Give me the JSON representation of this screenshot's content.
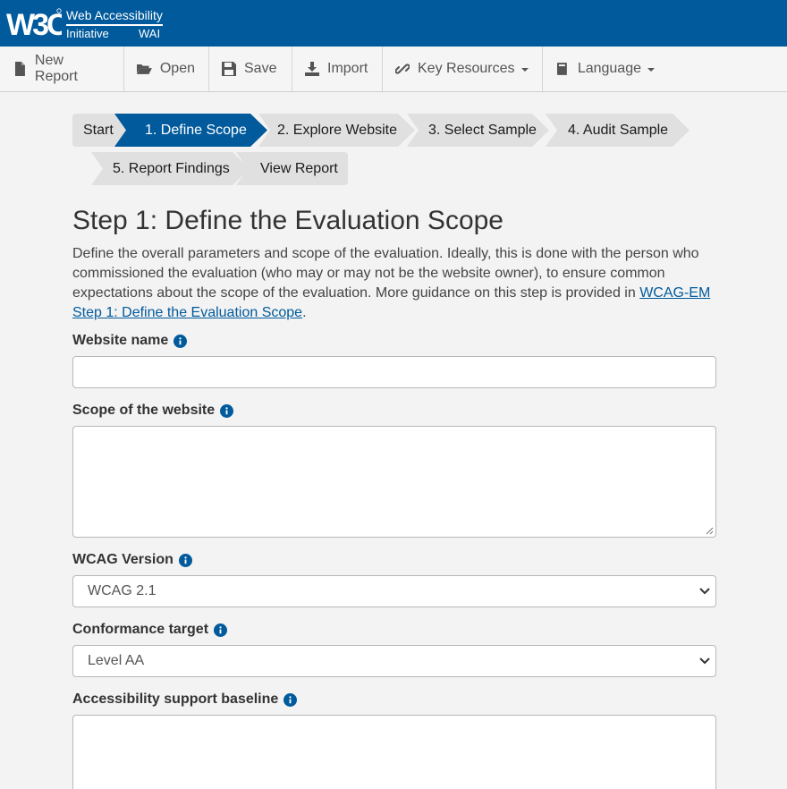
{
  "header": {
    "logo_text": "W3C",
    "wai_line1": "Web Accessibility",
    "wai_line2_left": "Initiative",
    "wai_line2_right": "WAI"
  },
  "toolbar": {
    "items": [
      {
        "label": "New Report",
        "icon": "file-icon"
      },
      {
        "label": "Open",
        "icon": "folder-open-icon"
      },
      {
        "label": "Save",
        "icon": "save-icon"
      },
      {
        "label": "Import",
        "icon": "import-icon"
      },
      {
        "label": "Key Resources",
        "icon": "link-icon",
        "dropdown": true
      },
      {
        "label": "Language",
        "icon": "book-icon",
        "dropdown": true
      }
    ]
  },
  "steps": [
    {
      "label": "Start"
    },
    {
      "label": "1. Define Scope",
      "active": true
    },
    {
      "label": "2. Explore Website"
    },
    {
      "label": "3. Select Sample"
    },
    {
      "label": "4. Audit Sample"
    },
    {
      "label": "5. Report Findings"
    },
    {
      "label": "View Report"
    }
  ],
  "main": {
    "title": "Step 1: Define the Evaluation Scope",
    "intro_text": "Define the overall parameters and scope of the evaluation. Ideally, this is done with the person who commissioned the evaluation (who may or may not be the website owner), to ensure common expectations about the scope of the evaluation. More guidance on this step is provided in ",
    "intro_link": "WCAG-EM Step 1: Define the Evaluation Scope",
    "intro_end": "."
  },
  "form": {
    "website_name_label": "Website name",
    "website_name_value": "",
    "scope_label": "Scope of the website",
    "scope_value": "",
    "wcag_version_label": "WCAG Version",
    "wcag_version_value": "WCAG 2.1",
    "conformance_label": "Conformance target",
    "conformance_value": "Level AA",
    "support_baseline_label": "Accessibility support baseline",
    "support_baseline_value": ""
  },
  "colors": {
    "brand": "#005a9c",
    "step_inactive": "#e0e0e0",
    "page_bg": "#f3f3f3"
  }
}
